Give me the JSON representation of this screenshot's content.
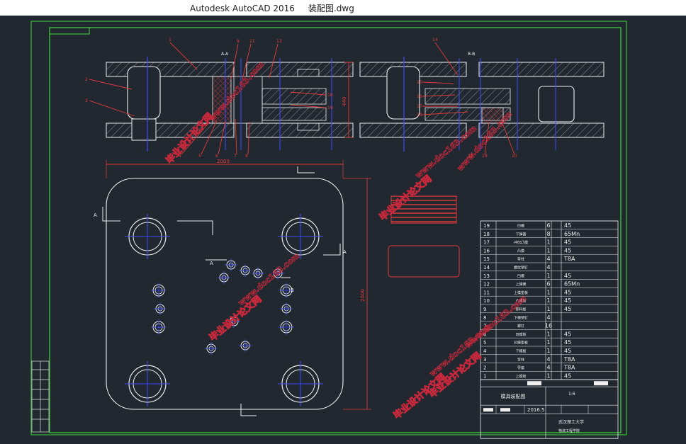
{
  "window": {
    "title": "Autodesk AutoCAD 2016     装配图.dwg"
  },
  "drawing": {
    "section_label_left": "A-A",
    "section_label_right": "B-B",
    "dim_width": "2000",
    "dim_height_plan": "2000",
    "dim_height_section": "440",
    "view_markers": [
      "A",
      "A",
      "A",
      "B"
    ],
    "callouts_left": [
      "1",
      "2",
      "3",
      "4",
      "5",
      "6",
      "7",
      "8",
      "9",
      "11",
      "13",
      "18",
      "19"
    ],
    "callouts_right": [
      "14",
      "15",
      "16",
      "17",
      "18",
      "19",
      "10",
      "12"
    ],
    "watermarks": [
      "毕业设计论文网",
      "www.doc163.com"
    ]
  },
  "bom": {
    "rows": [
      {
        "no": "19",
        "name": "凹模",
        "qty": "6",
        "mat": "45"
      },
      {
        "no": "18",
        "name": "下弹簧",
        "qty": "8",
        "mat": "65Mn"
      },
      {
        "no": "17",
        "name": "冲凹凸模",
        "qty": "1",
        "mat": "45"
      },
      {
        "no": "16",
        "name": "凸模",
        "qty": "1",
        "mat": "45"
      },
      {
        "no": "15",
        "name": "导柱",
        "qty": "4",
        "mat": "T8A"
      },
      {
        "no": "14",
        "name": "螺纹销钉",
        "qty": "4",
        "mat": ""
      },
      {
        "no": "13",
        "name": "凹模",
        "qty": "1",
        "mat": "45"
      },
      {
        "no": "12",
        "name": "上弹簧",
        "qty": "6",
        "mat": "65Mn"
      },
      {
        "no": "11",
        "name": "上模垫板",
        "qty": "1",
        "mat": "45"
      },
      {
        "no": "10",
        "name": "凸模板",
        "qty": "1",
        "mat": "45"
      },
      {
        "no": "9",
        "name": "卸料板",
        "qty": "1",
        "mat": "45"
      },
      {
        "no": "8",
        "name": "下模销钉",
        "qty": "4",
        "mat": ""
      },
      {
        "no": "7",
        "name": "螺钉",
        "qty": "16",
        "mat": ""
      },
      {
        "no": "6",
        "name": "凹模板",
        "qty": "1",
        "mat": "45"
      },
      {
        "no": "5",
        "name": "凹模垫板",
        "qty": "1",
        "mat": "45"
      },
      {
        "no": "4",
        "name": "下模板",
        "qty": "1",
        "mat": "45"
      },
      {
        "no": "3",
        "name": "导柱",
        "qty": "4",
        "mat": "T8A"
      },
      {
        "no": "2",
        "name": "导套",
        "qty": "4",
        "mat": "T8A"
      },
      {
        "no": "1",
        "name": "上模板",
        "qty": "1",
        "mat": "45"
      }
    ],
    "drawing_name": "模具装配图",
    "scale": "1:6",
    "date": "2016.5",
    "school": "武汉理工大学",
    "college": "物流工程学院"
  }
}
